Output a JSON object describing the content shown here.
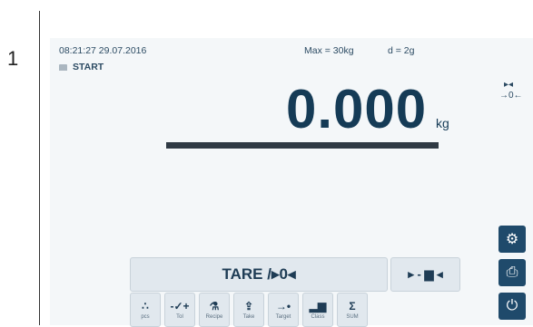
{
  "step_number": "1",
  "status": {
    "datetime": "08:21:27 29.07.2016",
    "max": "Max = 30kg",
    "d": "d = 2g",
    "mode": "START"
  },
  "weight": {
    "value": "0.000",
    "unit": "kg"
  },
  "indicators": {
    "top": "▸◂",
    "zero": "→0←"
  },
  "tare": {
    "label": "TARE /▸0◂",
    "preset_label": "▸ - ▆ ◂"
  },
  "functions": [
    {
      "icon": "∴",
      "label": "pcs",
      "icon_name": "pieces-icon"
    },
    {
      "icon": "-✓+",
      "label": "Tol",
      "icon_name": "tolerance-icon"
    },
    {
      "icon": "⚗",
      "label": "Recipe",
      "icon_name": "recipe-icon"
    },
    {
      "icon": "⇪",
      "label": "Take",
      "icon_name": "take-icon"
    },
    {
      "icon": "→•",
      "label": "Target",
      "icon_name": "target-icon"
    },
    {
      "icon": "▂▆",
      "label": "Class",
      "icon_name": "class-icon"
    },
    {
      "icon": "Σ",
      "label": "SUM",
      "icon_name": "sum-icon"
    }
  ],
  "side_buttons": [
    {
      "icon": "⚙",
      "icon_name": "gear-icon"
    },
    {
      "icon": "⎙",
      "icon_name": "print-icon"
    },
    {
      "icon": "⏻",
      "icon_name": "power-icon"
    }
  ],
  "colors": {
    "accent": "#1f4a6b",
    "background": "#f4f7f9",
    "text": "#153b56"
  }
}
